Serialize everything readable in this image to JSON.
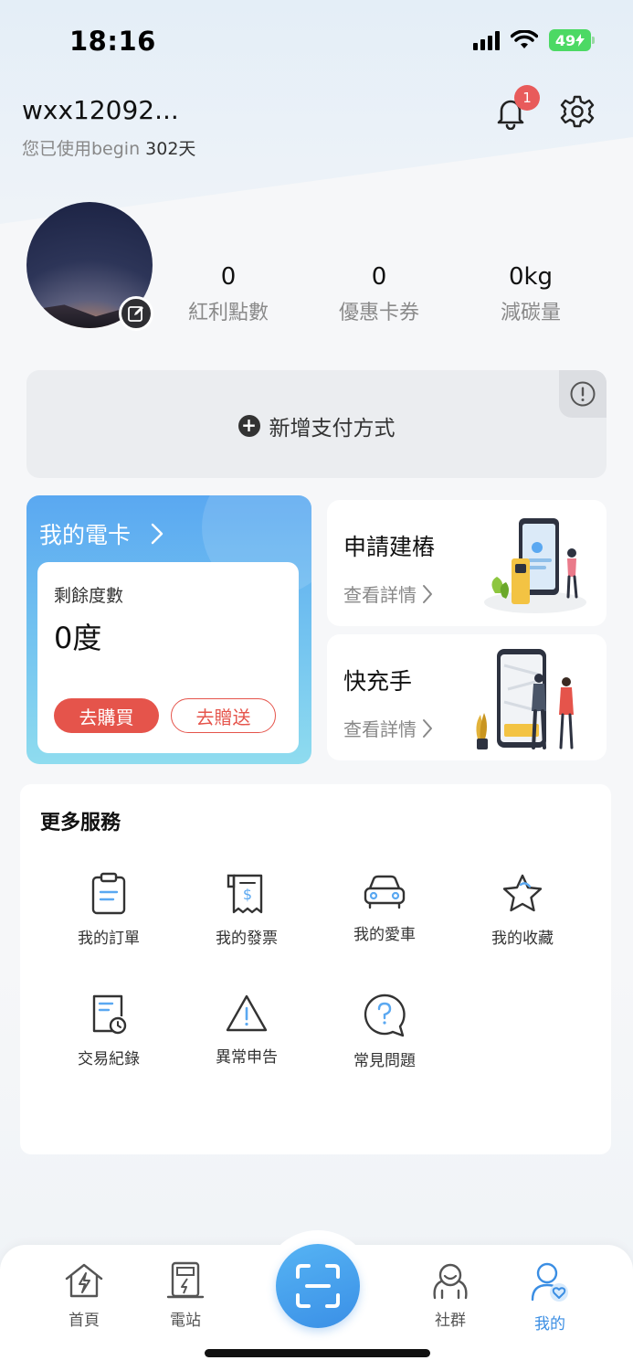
{
  "status_bar": {
    "time": "18:16",
    "battery": "49"
  },
  "header": {
    "username": "wxx12092...",
    "usage_prefix": "您已使用begin",
    "usage_days": "302天",
    "notification_count": "1"
  },
  "stats": [
    {
      "value": "0",
      "label": "紅利點數"
    },
    {
      "value": "0",
      "label": "優惠卡券"
    },
    {
      "value": "0kg",
      "label": "減碳量"
    }
  ],
  "payment": {
    "add_label": "新增支付方式"
  },
  "ecard": {
    "title": "我的電卡",
    "remaining_label": "剩餘度數",
    "remaining_value": "0度",
    "buy_label": "去購買",
    "gift_label": "去贈送"
  },
  "side_cards": [
    {
      "title": "申請建樁",
      "detail": "查看詳情"
    },
    {
      "title": "快充手",
      "detail": "查看詳情"
    }
  ],
  "services": {
    "title": "更多服務",
    "items": [
      {
        "label": "我的訂單",
        "icon": "clipboard-icon"
      },
      {
        "label": "我的發票",
        "icon": "receipt-icon"
      },
      {
        "label": "我的愛車",
        "icon": "car-icon"
      },
      {
        "label": "我的收藏",
        "icon": "star-icon"
      },
      {
        "label": "交易紀錄",
        "icon": "transaction-history-icon"
      },
      {
        "label": "異常申告",
        "icon": "warning-icon"
      },
      {
        "label": "常見問題",
        "icon": "faq-icon"
      }
    ]
  },
  "tabbar": {
    "items": [
      {
        "label": "首頁",
        "icon": "home-icon"
      },
      {
        "label": "電站",
        "icon": "charging-station-icon"
      },
      {
        "label": "社群",
        "icon": "community-icon"
      },
      {
        "label": "我的",
        "icon": "profile-icon"
      }
    ],
    "active": "我的"
  },
  "colors": {
    "accent": "#3b8ee3",
    "buy_red": "#e5544b",
    "card_blue": "#5aa8f1",
    "badge_red": "#e85b5b"
  }
}
